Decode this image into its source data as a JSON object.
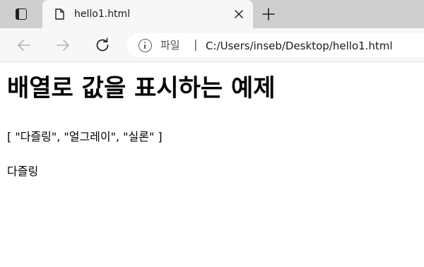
{
  "browser": {
    "tab": {
      "title": "hello1.html"
    },
    "address_bar": {
      "file_label": "파일",
      "separator": "|",
      "url": "C:/Users/inseb/Desktop/hello1.html"
    },
    "icons": {
      "tab_actions": "tab-actions-icon",
      "page": "page-icon",
      "close": "close-icon",
      "new_tab": "plus-icon",
      "back": "arrow-left-icon",
      "forward": "arrow-right-icon",
      "refresh": "refresh-icon",
      "info": "info-icon"
    }
  },
  "page": {
    "title": "배열로 값을 표시하는 예제",
    "array_output": "[ \"다즐링\", \"얼그레이\", \"실론\" ]",
    "value_output": "다즐링"
  },
  "colors": {
    "tab_strip": "#cfcfcf",
    "active_tab": "#f7f7f7",
    "toolbar": "#f7f7f7",
    "page_background": "#ffffff"
  }
}
